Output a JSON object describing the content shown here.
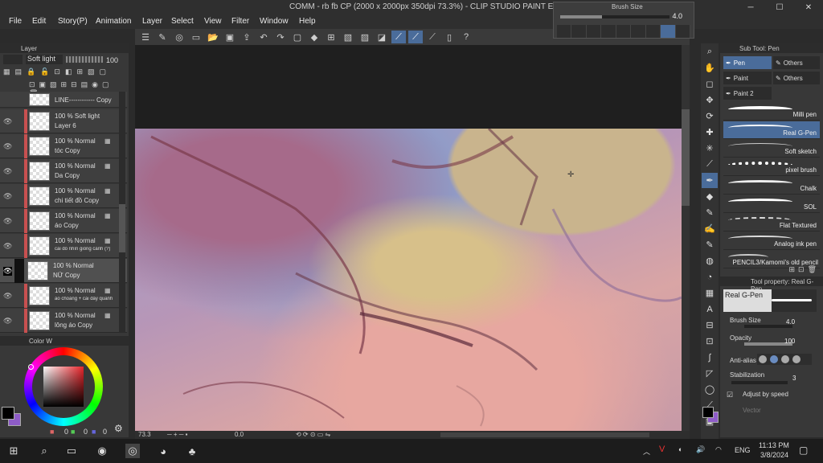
{
  "window": {
    "title": "COMM - rb fb CP (2000 x 2000px 350dpi 73.3%) - CLIP STUDIO PAINT EX"
  },
  "menu": [
    "File",
    "Edit",
    "Story(P)",
    "Animation",
    "Layer",
    "Select",
    "View",
    "Filter",
    "Window",
    "Help"
  ],
  "brush_size_popup": {
    "label": "Brush Size",
    "value": "4.0"
  },
  "layer_panel": {
    "tab": "Layer",
    "blend_mode": "Soft light",
    "opacity": "100",
    "layers": [
      {
        "line1": "LINE------------ Copy",
        "line2": ""
      },
      {
        "line1": "100 % Soft light",
        "line2": "Layer 6"
      },
      {
        "line1": "100 % Normal",
        "line2": "tóc Copy"
      },
      {
        "line1": "100 % Normal",
        "line2": "Da Copy"
      },
      {
        "line1": "100 % Normal",
        "line2": "chi tiết đồ Copy"
      },
      {
        "line1": "100 % Normal",
        "line2": "áo Copy"
      },
      {
        "line1": "100 % Normal",
        "line2": "cái đồ nhìn giống cánh (?)"
      },
      {
        "line1": "100 % Normal",
        "line2": "NỮ Copy"
      },
      {
        "line1": "100 % Normal",
        "line2": "áo choàng + cái dây quanh"
      },
      {
        "line1": "100 % Normal",
        "line2": "lông áo Copy"
      }
    ]
  },
  "color_panel": {
    "tab": "Color W",
    "values": [
      "0",
      "0",
      "0"
    ]
  },
  "status": {
    "zoom": "73.3",
    "rotation": "0.0"
  },
  "subtool_panel": {
    "tab": "Sub Tool: Pen",
    "groups": [
      "Pen",
      "Others",
      "Paint",
      "Others",
      "Paint 2"
    ],
    "brushes": [
      "Milli pen",
      "Real G-Pen",
      "Soft sketch",
      "pixel brush",
      "Chalk",
      "SOL",
      "Flat Textured",
      "Analog ink pen",
      "PENCIL3/Kamomi's old pencil"
    ]
  },
  "tool_property": {
    "tab": "Tool property: Real G-Pen",
    "preview_label": "Real G-Pen",
    "brush_size_label": "Brush Size",
    "brush_size": "4.0",
    "opacity_label": "Opacity",
    "opacity": "100",
    "anti_alias_label": "Anti-alias",
    "stabilization_label": "Stabilization",
    "stabilization": "3",
    "adjust_label": "Adjust by speed",
    "vector_label": "Vector"
  },
  "taskbar": {
    "lang": "ENG",
    "time": "11:13 PM",
    "date": "3/8/2024"
  },
  "colors": {
    "accent": "#4a6c9a",
    "main_color": "#000000",
    "sub_color": "#8e5cc7"
  }
}
